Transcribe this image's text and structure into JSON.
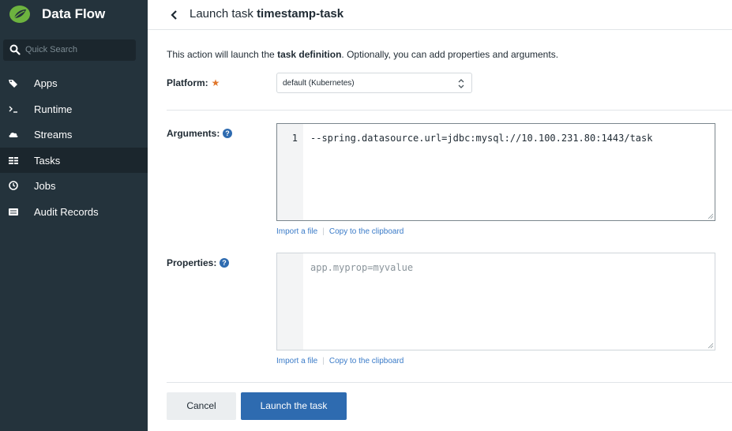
{
  "sidebar": {
    "brand_title": "Data Flow",
    "search_placeholder": "Quick Search",
    "items": [
      {
        "label": "Apps",
        "icon": "tag-icon"
      },
      {
        "label": "Runtime",
        "icon": "terminal-icon"
      },
      {
        "label": "Streams",
        "icon": "cloud-icon"
      },
      {
        "label": "Tasks",
        "icon": "tasks-icon",
        "active": true
      },
      {
        "label": "Jobs",
        "icon": "clock-icon"
      },
      {
        "label": "Audit Records",
        "icon": "list-icon"
      }
    ]
  },
  "header": {
    "prefix": "Launch task ",
    "task_name": "timestamp-task"
  },
  "intro": {
    "part1": "This action will launch the ",
    "bold": "task definition",
    "part2": ". Optionally, you can add properties and arguments."
  },
  "platform": {
    "label": "Platform:",
    "required_mark": "★",
    "selected": "default (Kubernetes)"
  },
  "arguments": {
    "label": "Arguments:",
    "line_number": "1",
    "value": "--spring.datasource.url=jdbc:mysql://10.100.231.80:1443/task"
  },
  "properties": {
    "label": "Properties:",
    "placeholder": "app.myprop=myvalue"
  },
  "links": {
    "import": "Import a file",
    "copy": "Copy to the clipboard",
    "separator": "|"
  },
  "buttons": {
    "cancel": "Cancel",
    "launch": "Launch the task"
  },
  "colors": {
    "sidebar_bg": "#24333c",
    "accent": "#2e6bb0",
    "required": "#e0762b",
    "link": "#3a7bc8"
  }
}
